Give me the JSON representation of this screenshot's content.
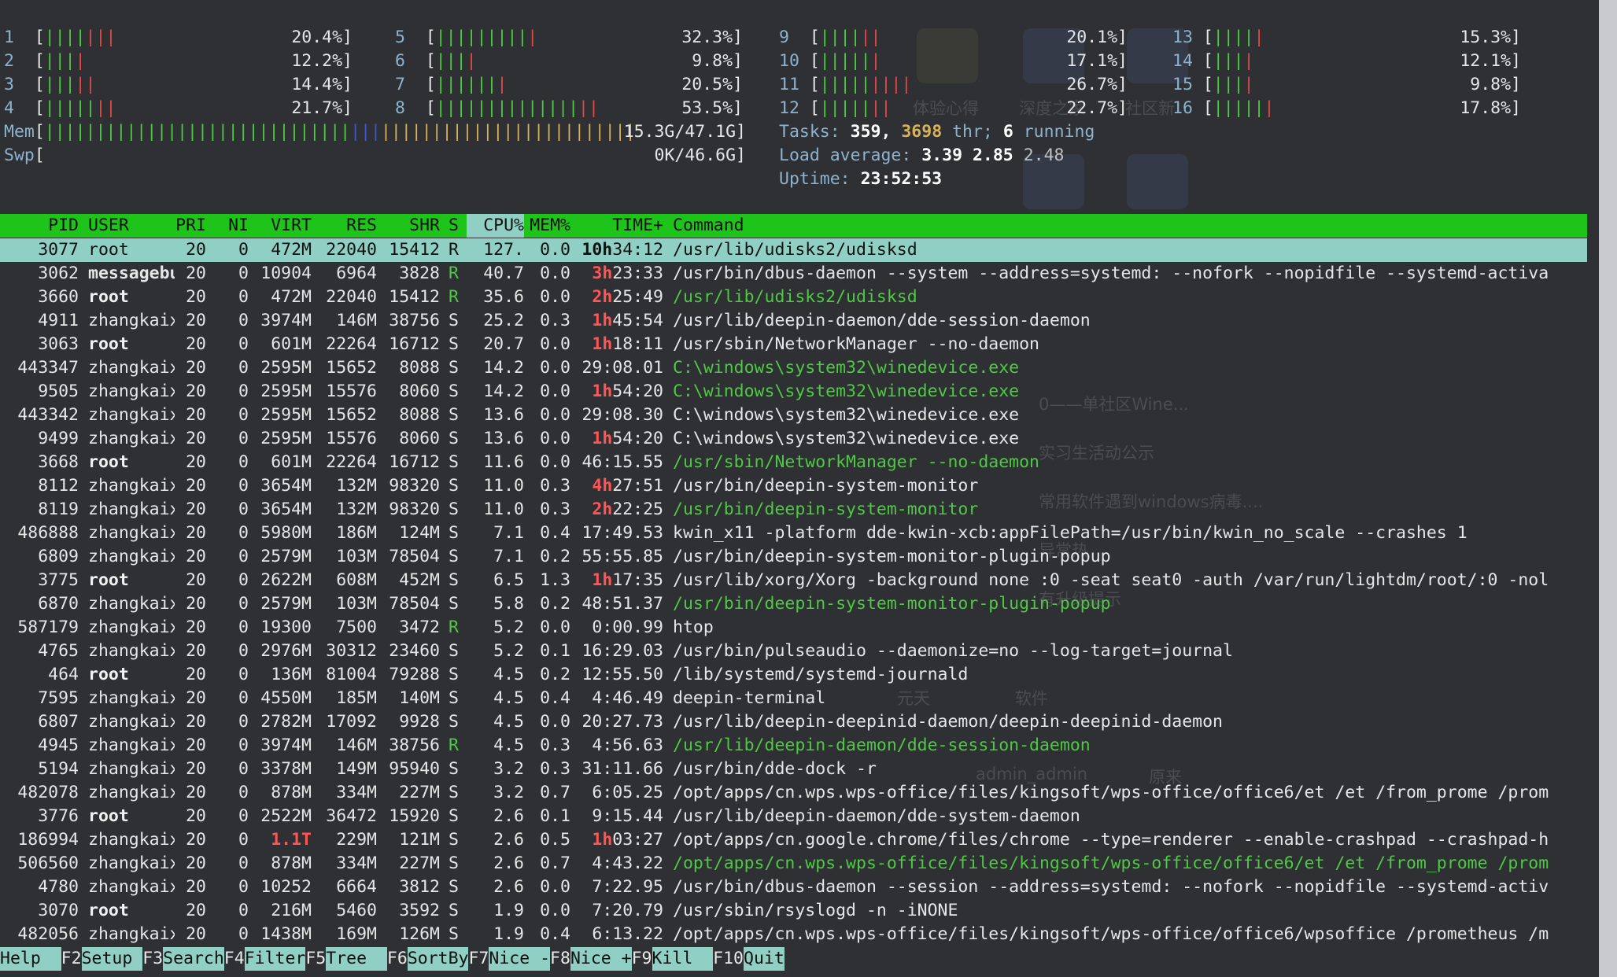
{
  "cpus": [
    {
      "n": "1",
      "g": "||||",
      "r": "|||",
      "pct": "20.4%]"
    },
    {
      "n": "2",
      "g": "|||",
      "r": "|",
      "pct": "12.2%]"
    },
    {
      "n": "3",
      "g": "|||",
      "r": "||",
      "pct": "14.4%]"
    },
    {
      "n": "4",
      "g": "|||||",
      "r": "||",
      "pct": "21.7%]"
    },
    {
      "n": "5",
      "g": "|||||||||",
      "r": "|",
      "pct": "32.3%]"
    },
    {
      "n": "6",
      "g": "|||",
      "r": "|",
      "pct": "9.8%]"
    },
    {
      "n": "7",
      "g": "||||||",
      "r": "|",
      "pct": "20.5%]"
    },
    {
      "n": "8",
      "g": "||||||||||||||",
      "r": "||",
      "pct": "53.5%]"
    },
    {
      "n": "9",
      "g": "||||",
      "r": "||",
      "pct": "20.1%]"
    },
    {
      "n": "10",
      "g": "|||||",
      "r": "|",
      "pct": "17.1%]"
    },
    {
      "n": "11",
      "g": "|||||",
      "r": "||||",
      "pct": "26.7%]"
    },
    {
      "n": "12",
      "g": "|||||",
      "r": "||",
      "pct": "22.7%]"
    },
    {
      "n": "13",
      "g": "||||",
      "r": "|",
      "pct": "15.3%]"
    },
    {
      "n": "14",
      "g": "|||",
      "r": "|",
      "pct": "12.1%]"
    },
    {
      "n": "15",
      "g": "|||",
      "r": "|",
      "pct": "9.8%]"
    },
    {
      "n": "16",
      "g": "|||||",
      "r": "|",
      "pct": "17.8%]"
    }
  ],
  "mem": {
    "label": "Mem",
    "value": "15.3G/47.1G]"
  },
  "swp": {
    "label": "Swp",
    "value": "0K/46.6G]"
  },
  "tasks": {
    "label": "Tasks:",
    "count": "359,",
    "thr": "3698",
    "thr_label": "thr;",
    "running": "6",
    "running_label": "running"
  },
  "load": {
    "label": "Load average:",
    "a": "3.39",
    "b": "2.85",
    "c": "2.48"
  },
  "uptime": {
    "label": "Uptime:",
    "value": "23:52:53"
  },
  "columns": [
    "PID",
    "USER",
    "PRI",
    "NI",
    "VIRT",
    "RES",
    "SHR",
    "S",
    "CPU%",
    "MEM%",
    "TIME+",
    "Command"
  ],
  "processes": [
    {
      "pid": "3077",
      "user": "root",
      "pri": "20",
      "ni": "0",
      "virt": "472M",
      "res": "22040",
      "shr": "15412",
      "s": "R",
      "cpu": "127.",
      "mem": "0.0",
      "th": "10h",
      "tm": "34:12",
      "cmd": "/usr/lib/udisks2/udisksd"
    },
    {
      "pid": "3062",
      "user": "messagebu",
      "pri": "20",
      "ni": "0",
      "virt": "10904",
      "res": "6964",
      "shr": "3828",
      "s": "R",
      "cpu": "40.7",
      "mem": "0.0",
      "th": "3h",
      "tm": "23:33",
      "cmd": "/usr/bin/dbus-daemon --system --address=systemd: --nofork --nopidfile --systemd-activa"
    },
    {
      "pid": "3660",
      "user": "root",
      "pri": "20",
      "ni": "0",
      "virt": "472M",
      "res": "22040",
      "shr": "15412",
      "s": "R",
      "cpu": "35.6",
      "mem": "0.0",
      "th": "2h",
      "tm": "25:49",
      "cmd": "/usr/lib/udisks2/udisksd"
    },
    {
      "pid": "4911",
      "user": "zhangkaix",
      "pri": "20",
      "ni": "0",
      "virt": "3974M",
      "res": "146M",
      "shr": "38756",
      "s": "S",
      "cpu": "25.2",
      "mem": "0.3",
      "th": "1h",
      "tm": "45:54",
      "cmd": "/usr/lib/deepin-daemon/dde-session-daemon"
    },
    {
      "pid": "3063",
      "user": "root",
      "pri": "20",
      "ni": "0",
      "virt": "601M",
      "res": "22264",
      "shr": "16712",
      "s": "S",
      "cpu": "20.7",
      "mem": "0.0",
      "th": "1h",
      "tm": "18:11",
      "cmd": "/usr/sbin/NetworkManager --no-daemon"
    },
    {
      "pid": "443347",
      "user": "zhangkaix",
      "pri": "20",
      "ni": "0",
      "virt": "2595M",
      "res": "15652",
      "shr": "8088",
      "s": "S",
      "cpu": "14.2",
      "mem": "0.0",
      "th": "",
      "tm": "29:08.01",
      "cmd": "C:\\windows\\system32\\winedevice.exe"
    },
    {
      "pid": "9505",
      "user": "zhangkaix",
      "pri": "20",
      "ni": "0",
      "virt": "2595M",
      "res": "15576",
      "shr": "8060",
      "s": "S",
      "cpu": "14.2",
      "mem": "0.0",
      "th": "1h",
      "tm": "54:20",
      "cmd": "C:\\windows\\system32\\winedevice.exe"
    },
    {
      "pid": "443342",
      "user": "zhangkaix",
      "pri": "20",
      "ni": "0",
      "virt": "2595M",
      "res": "15652",
      "shr": "8088",
      "s": "S",
      "cpu": "13.6",
      "mem": "0.0",
      "th": "",
      "tm": "29:08.30",
      "cmd": "C:\\windows\\system32\\winedevice.exe"
    },
    {
      "pid": "9499",
      "user": "zhangkaix",
      "pri": "20",
      "ni": "0",
      "virt": "2595M",
      "res": "15576",
      "shr": "8060",
      "s": "S",
      "cpu": "13.6",
      "mem": "0.0",
      "th": "1h",
      "tm": "54:20",
      "cmd": "C:\\windows\\system32\\winedevice.exe"
    },
    {
      "pid": "3668",
      "user": "root",
      "pri": "20",
      "ni": "0",
      "virt": "601M",
      "res": "22264",
      "shr": "16712",
      "s": "S",
      "cpu": "11.6",
      "mem": "0.0",
      "th": "",
      "tm": "46:15.55",
      "cmd": "/usr/sbin/NetworkManager --no-daemon"
    },
    {
      "pid": "8112",
      "user": "zhangkaix",
      "pri": "20",
      "ni": "0",
      "virt": "3654M",
      "res": "132M",
      "shr": "98320",
      "s": "S",
      "cpu": "11.0",
      "mem": "0.3",
      "th": "4h",
      "tm": "27:51",
      "cmd": "/usr/bin/deepin-system-monitor"
    },
    {
      "pid": "8119",
      "user": "zhangkaix",
      "pri": "20",
      "ni": "0",
      "virt": "3654M",
      "res": "132M",
      "shr": "98320",
      "s": "S",
      "cpu": "11.0",
      "mem": "0.3",
      "th": "2h",
      "tm": "22:25",
      "cmd": "/usr/bin/deepin-system-monitor"
    },
    {
      "pid": "486888",
      "user": "zhangkaix",
      "pri": "20",
      "ni": "0",
      "virt": "5980M",
      "res": "186M",
      "shr": "124M",
      "s": "S",
      "cpu": "7.1",
      "mem": "0.4",
      "th": "",
      "tm": "17:49.53",
      "cmd": "kwin_x11 -platform dde-kwin-xcb:appFilePath=/usr/bin/kwin_no_scale --crashes 1"
    },
    {
      "pid": "6809",
      "user": "zhangkaix",
      "pri": "20",
      "ni": "0",
      "virt": "2579M",
      "res": "103M",
      "shr": "78504",
      "s": "S",
      "cpu": "7.1",
      "mem": "0.2",
      "th": "",
      "tm": "55:55.85",
      "cmd": "/usr/bin/deepin-system-monitor-plugin-popup"
    },
    {
      "pid": "3775",
      "user": "root",
      "pri": "20",
      "ni": "0",
      "virt": "2622M",
      "res": "608M",
      "shr": "452M",
      "s": "S",
      "cpu": "6.5",
      "mem": "1.3",
      "th": "1h",
      "tm": "17:35",
      "cmd": "/usr/lib/xorg/Xorg -background none :0 -seat seat0 -auth /var/run/lightdm/root/:0 -nol"
    },
    {
      "pid": "6870",
      "user": "zhangkaix",
      "pri": "20",
      "ni": "0",
      "virt": "2579M",
      "res": "103M",
      "shr": "78504",
      "s": "S",
      "cpu": "5.8",
      "mem": "0.2",
      "th": "",
      "tm": "48:51.37",
      "cmd": "/usr/bin/deepin-system-monitor-plugin-popup"
    },
    {
      "pid": "587179",
      "user": "zhangkaix",
      "pri": "20",
      "ni": "0",
      "virt": "19300",
      "res": "7500",
      "shr": "3472",
      "s": "R",
      "cpu": "5.2",
      "mem": "0.0",
      "th": "",
      "tm": "0:00.99",
      "cmd": "htop"
    },
    {
      "pid": "4765",
      "user": "zhangkaix",
      "pri": "20",
      "ni": "0",
      "virt": "2976M",
      "res": "30312",
      "shr": "23460",
      "s": "S",
      "cpu": "5.2",
      "mem": "0.1",
      "th": "",
      "tm": "16:29.03",
      "cmd": "/usr/bin/pulseaudio --daemonize=no --log-target=journal"
    },
    {
      "pid": "464",
      "user": "root",
      "pri": "20",
      "ni": "0",
      "virt": "136M",
      "res": "81004",
      "shr": "79288",
      "s": "S",
      "cpu": "4.5",
      "mem": "0.2",
      "th": "",
      "tm": "12:55.50",
      "cmd": "/lib/systemd/systemd-journald"
    },
    {
      "pid": "7595",
      "user": "zhangkaix",
      "pri": "20",
      "ni": "0",
      "virt": "4550M",
      "res": "185M",
      "shr": "140M",
      "s": "S",
      "cpu": "4.5",
      "mem": "0.4",
      "th": "",
      "tm": "4:46.49",
      "cmd": "deepin-terminal"
    },
    {
      "pid": "6807",
      "user": "zhangkaix",
      "pri": "20",
      "ni": "0",
      "virt": "2782M",
      "res": "17092",
      "shr": "9928",
      "s": "S",
      "cpu": "4.5",
      "mem": "0.0",
      "th": "",
      "tm": "20:27.73",
      "cmd": "/usr/lib/deepin-deepinid-daemon/deepin-deepinid-daemon"
    },
    {
      "pid": "4945",
      "user": "zhangkaix",
      "pri": "20",
      "ni": "0",
      "virt": "3974M",
      "res": "146M",
      "shr": "38756",
      "s": "R",
      "cpu": "4.5",
      "mem": "0.3",
      "th": "",
      "tm": "4:56.63",
      "cmd": "/usr/lib/deepin-daemon/dde-session-daemon"
    },
    {
      "pid": "5194",
      "user": "zhangkaix",
      "pri": "20",
      "ni": "0",
      "virt": "3378M",
      "res": "149M",
      "shr": "95940",
      "s": "S",
      "cpu": "3.2",
      "mem": "0.3",
      "th": "",
      "tm": "31:11.66",
      "cmd": "/usr/bin/dde-dock -r"
    },
    {
      "pid": "482078",
      "user": "zhangkaix",
      "pri": "20",
      "ni": "0",
      "virt": "878M",
      "res": "334M",
      "shr": "227M",
      "s": "S",
      "cpu": "3.2",
      "mem": "0.7",
      "th": "",
      "tm": "6:05.25",
      "cmd": "/opt/apps/cn.wps.wps-office/files/kingsoft/wps-office/office6/et /et /from_prome /prom"
    },
    {
      "pid": "3776",
      "user": "root",
      "pri": "20",
      "ni": "0",
      "virt": "2522M",
      "res": "36472",
      "shr": "15920",
      "s": "S",
      "cpu": "2.6",
      "mem": "0.1",
      "th": "",
      "tm": "9:15.44",
      "cmd": "/usr/lib/deepin-daemon/dde-system-daemon"
    },
    {
      "pid": "186994",
      "user": "zhangkaix",
      "pri": "20",
      "ni": "0",
      "virt": "1.1T",
      "res": "229M",
      "shr": "121M",
      "s": "S",
      "cpu": "2.6",
      "mem": "0.5",
      "th": "1h",
      "tm": "03:27",
      "cmd": "/opt/apps/cn.google.chrome/files/chrome --type=renderer --enable-crashpad --crashpad-h"
    },
    {
      "pid": "506560",
      "user": "zhangkaix",
      "pri": "20",
      "ni": "0",
      "virt": "878M",
      "res": "334M",
      "shr": "227M",
      "s": "S",
      "cpu": "2.6",
      "mem": "0.7",
      "th": "",
      "tm": "4:43.22",
      "cmd": "/opt/apps/cn.wps.wps-office/files/kingsoft/wps-office/office6/et /et /from_prome /prom"
    },
    {
      "pid": "4780",
      "user": "zhangkaix",
      "pri": "20",
      "ni": "0",
      "virt": "10252",
      "res": "6664",
      "shr": "3812",
      "s": "S",
      "cpu": "2.6",
      "mem": "0.0",
      "th": "",
      "tm": "7:22.95",
      "cmd": "/usr/bin/dbus-daemon --session --address=systemd: --nofork --nopidfile --systemd-activ"
    },
    {
      "pid": "3070",
      "user": "root",
      "pri": "20",
      "ni": "0",
      "virt": "216M",
      "res": "5460",
      "shr": "3592",
      "s": "S",
      "cpu": "1.9",
      "mem": "0.0",
      "th": "",
      "tm": "7:20.79",
      "cmd": "/usr/sbin/rsyslogd -n -iNONE"
    },
    {
      "pid": "482056",
      "user": "zhangkaix",
      "pri": "20",
      "ni": "0",
      "virt": "1438M",
      "res": "169M",
      "shr": "126M",
      "s": "S",
      "cpu": "1.9",
      "mem": "0.4",
      "th": "",
      "tm": "6:13.22",
      "cmd": "/opt/apps/cn.wps.wps-office/files/kingsoft/wps-office/office6/wpsoffice /prometheus /m"
    }
  ],
  "fkeys": [
    {
      "k": "",
      "label": "Help  "
    },
    {
      "k": "F2",
      "label": "Setup "
    },
    {
      "k": "F3",
      "label": "Search"
    },
    {
      "k": "F4",
      "label": "Filter"
    },
    {
      "k": "F5",
      "label": "Tree  "
    },
    {
      "k": "F6",
      "label": "SortBy"
    },
    {
      "k": "F7",
      "label": "Nice -"
    },
    {
      "k": "F8",
      "label": "Nice +"
    },
    {
      "k": "F9",
      "label": "Kill  "
    },
    {
      "k": "F10",
      "label": "Quit"
    }
  ],
  "background_text": [
    "体验心得",
    "深度之家",
    "社区新",
    "0——单社区Wine...",
    "实习生活动公示",
    "常用软件遇到windows病毒....",
    "异常热",
    "有升级提示",
    "元天",
    "软件",
    "admin_admin",
    "原来"
  ],
  "colors": {
    "header_bar": "#1ec41a",
    "selected_row": "#8fcfc4",
    "green_bar": "#4eca42",
    "red_bar": "#e04848",
    "highlight_red": "#ff5555"
  }
}
